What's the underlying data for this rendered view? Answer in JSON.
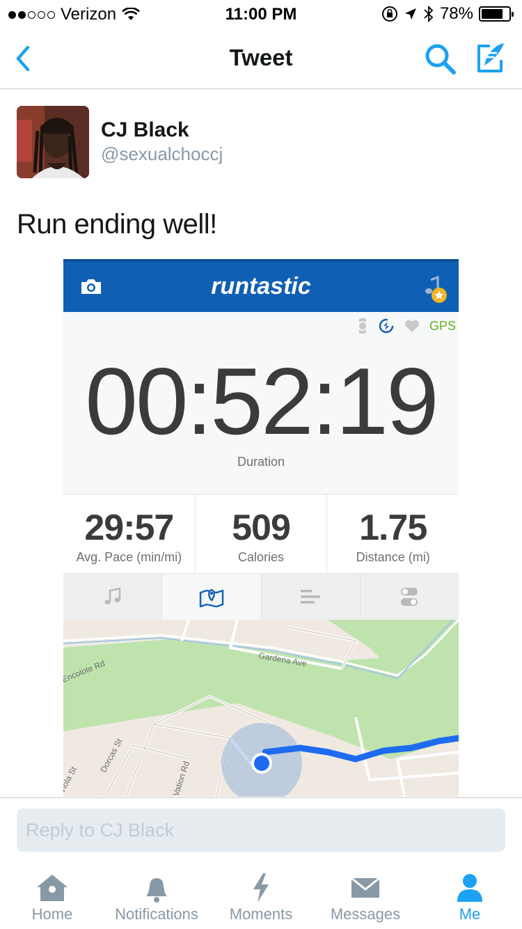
{
  "status_bar": {
    "carrier": "Verizon",
    "time": "11:00 PM",
    "battery": "78%",
    "battery_level": 0.78,
    "signal_bars": 2
  },
  "nav": {
    "title": "Tweet",
    "back_icon": "chevron-left-icon",
    "search_icon": "search-icon",
    "compose_icon": "compose-tweet-icon",
    "accent_color": "#1da1f2"
  },
  "tweet": {
    "name": "CJ Black",
    "handle": "@sexualchoccj",
    "text": "Run ending well!"
  },
  "runtastic": {
    "logo": "runtastic",
    "header_color": "#0f5fb4",
    "gps_label": "GPS",
    "duration": "00:52:19",
    "duration_label": "Duration",
    "stats": [
      {
        "value": "29:57",
        "label": "Avg. Pace (min/mi)"
      },
      {
        "value": "509",
        "label": "Calories"
      },
      {
        "value": "1.75",
        "label": "Distance (mi)"
      }
    ],
    "tabs": [
      "music-icon",
      "map-icon",
      "stats-icon",
      "toggle-icon"
    ],
    "map": {
      "streets": [
        "Gardena Ave",
        "Encolote Rd",
        "Dorcas St",
        "Viola St",
        "Vation Rd"
      ]
    }
  },
  "reply": {
    "placeholder": "Reply to CJ Black"
  },
  "tab_bar": {
    "items": [
      {
        "label": "Home",
        "icon": "home-icon"
      },
      {
        "label": "Notifications",
        "icon": "bell-icon"
      },
      {
        "label": "Moments",
        "icon": "lightning-icon"
      },
      {
        "label": "Messages",
        "icon": "envelope-icon"
      },
      {
        "label": "Me",
        "icon": "person-icon"
      }
    ],
    "active": "Me"
  }
}
